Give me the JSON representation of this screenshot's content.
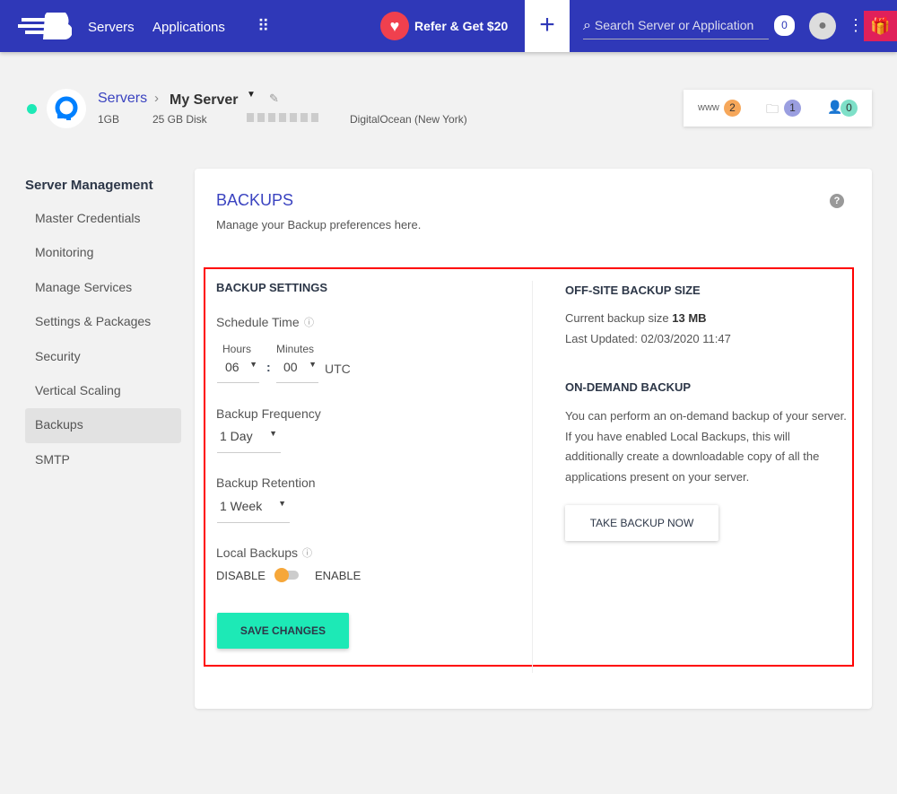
{
  "topbar": {
    "nav": [
      "Servers",
      "Applications"
    ],
    "refer": "Refer & Get $20",
    "search_placeholder": "Search Server or Application",
    "notifications": "0"
  },
  "server": {
    "breadcrumb_root": "Servers",
    "name": "My Server",
    "ram": "1GB",
    "disk": "25 GB Disk",
    "provider": "DigitalOcean (New York)",
    "status_color": "#1de9b6",
    "stats": [
      {
        "icon": "www",
        "count": "2",
        "color": "#f6a75a"
      },
      {
        "icon": "folder-icon",
        "count": "1",
        "color": "#9a9ee0"
      },
      {
        "icon": "user-icon",
        "count": "0",
        "color": "#7ee0c8"
      }
    ]
  },
  "sidebar": {
    "title": "Server Management",
    "items": [
      "Master Credentials",
      "Monitoring",
      "Manage Services",
      "Settings & Packages",
      "Security",
      "Vertical Scaling",
      "Backups",
      "SMTP"
    ],
    "active": "Backups"
  },
  "main": {
    "title": "BACKUPS",
    "subtitle": "Manage your Backup preferences here.",
    "settings": {
      "title": "BACKUP SETTINGS",
      "schedule_label": "Schedule Time",
      "hours_label": "Hours",
      "minutes_label": "Minutes",
      "hours": "06",
      "minutes": "00",
      "tz": "UTC",
      "frequency_label": "Backup Frequency",
      "frequency": "1 Day",
      "retention_label": "Backup Retention",
      "retention": "1 Week",
      "local_label": "Local Backups",
      "disable": "DISABLE",
      "enable": "ENABLE",
      "local_enabled": false,
      "save": "SAVE CHANGES"
    },
    "offsite": {
      "title": "OFF-SITE BACKUP SIZE",
      "size_label": "Current backup size",
      "size": "13 MB",
      "updated": "Last Updated: 02/03/2020 11:47"
    },
    "ondemand": {
      "title": "ON-DEMAND BACKUP",
      "text": "You can perform an on-demand backup of your server. If you have enabled Local Backups, this will additionally create a downloadable copy of all the applications present on your server.",
      "button": "TAKE BACKUP NOW"
    }
  }
}
